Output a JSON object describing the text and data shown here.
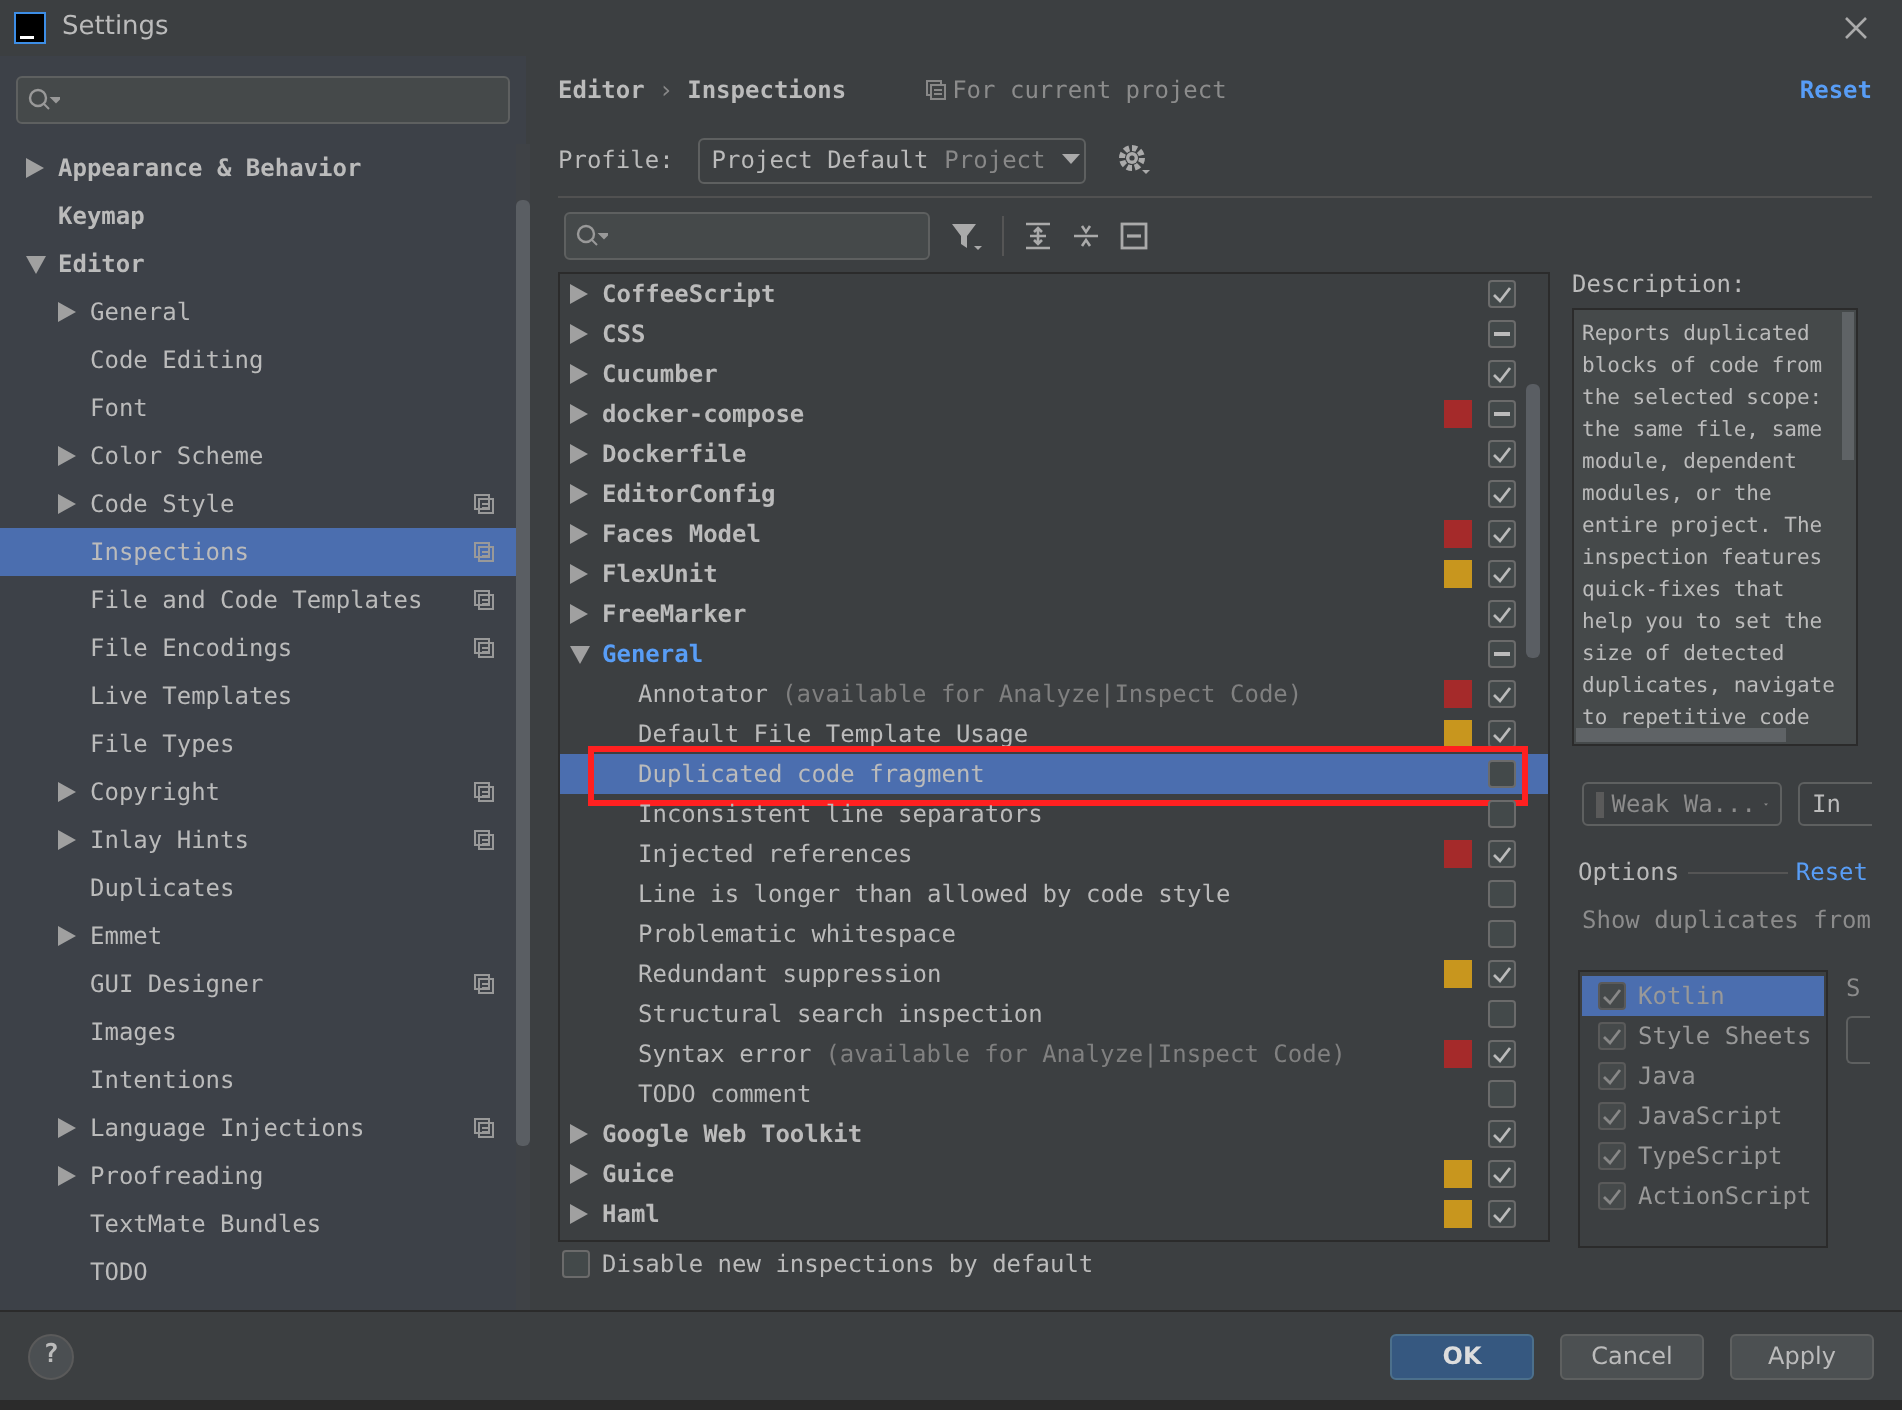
{
  "window": {
    "title": "Settings"
  },
  "sidebar": {
    "items": [
      {
        "label": "Appearance & Behavior",
        "kind": "group",
        "expanded": false,
        "selected": false,
        "project_scoped": false
      },
      {
        "label": "Keymap",
        "kind": "leaf",
        "selected": false,
        "project_scoped": false
      },
      {
        "label": "Editor",
        "kind": "group",
        "expanded": true,
        "selected": false,
        "project_scoped": false,
        "children": [
          {
            "label": "General",
            "kind": "group",
            "expanded": false,
            "selected": false,
            "project_scoped": false
          },
          {
            "label": "Code Editing",
            "kind": "leaf",
            "selected": false,
            "project_scoped": false
          },
          {
            "label": "Font",
            "kind": "leaf",
            "selected": false,
            "project_scoped": false
          },
          {
            "label": "Color Scheme",
            "kind": "group",
            "expanded": false,
            "selected": false,
            "project_scoped": false
          },
          {
            "label": "Code Style",
            "kind": "group",
            "expanded": false,
            "selected": false,
            "project_scoped": true
          },
          {
            "label": "Inspections",
            "kind": "leaf",
            "selected": true,
            "project_scoped": true
          },
          {
            "label": "File and Code Templates",
            "kind": "leaf",
            "selected": false,
            "project_scoped": true
          },
          {
            "label": "File Encodings",
            "kind": "leaf",
            "selected": false,
            "project_scoped": true
          },
          {
            "label": "Live Templates",
            "kind": "leaf",
            "selected": false,
            "project_scoped": false
          },
          {
            "label": "File Types",
            "kind": "leaf",
            "selected": false,
            "project_scoped": false
          },
          {
            "label": "Copyright",
            "kind": "group",
            "expanded": false,
            "selected": false,
            "project_scoped": true
          },
          {
            "label": "Inlay Hints",
            "kind": "group",
            "expanded": false,
            "selected": false,
            "project_scoped": true
          },
          {
            "label": "Duplicates",
            "kind": "leaf",
            "selected": false,
            "project_scoped": false
          },
          {
            "label": "Emmet",
            "kind": "group",
            "expanded": false,
            "selected": false,
            "project_scoped": false
          },
          {
            "label": "GUI Designer",
            "kind": "leaf",
            "selected": false,
            "project_scoped": true
          },
          {
            "label": "Images",
            "kind": "leaf",
            "selected": false,
            "project_scoped": false
          },
          {
            "label": "Intentions",
            "kind": "leaf",
            "selected": false,
            "project_scoped": false
          },
          {
            "label": "Language Injections",
            "kind": "group",
            "expanded": false,
            "selected": false,
            "project_scoped": true
          },
          {
            "label": "Proofreading",
            "kind": "group",
            "expanded": false,
            "selected": false,
            "project_scoped": false
          },
          {
            "label": "TextMate Bundles",
            "kind": "leaf",
            "selected": false,
            "project_scoped": false
          },
          {
            "label": "TODO",
            "kind": "leaf",
            "selected": false,
            "project_scoped": false
          }
        ]
      }
    ]
  },
  "breadcrumb": [
    "Editor",
    "›",
    "Inspections"
  ],
  "scope_note": "For current project",
  "reset": "Reset",
  "profile": {
    "label": "Profile:",
    "value": "Project Default",
    "scope": "Project"
  },
  "inspections": [
    {
      "name": "CoffeeScript",
      "kind": "group",
      "expanded": false,
      "checked": true,
      "mixed": false,
      "selected": false,
      "framed": false
    },
    {
      "name": "CSS",
      "kind": "group",
      "expanded": false,
      "checked": false,
      "mixed": true,
      "selected": false,
      "framed": false
    },
    {
      "name": "Cucumber",
      "kind": "group",
      "expanded": false,
      "checked": true,
      "mixed": false,
      "selected": false,
      "framed": false
    },
    {
      "name": "docker-compose",
      "kind": "group",
      "expanded": false,
      "color": "#a52a2a",
      "checked": false,
      "mixed": true,
      "selected": false,
      "framed": false
    },
    {
      "name": "Dockerfile",
      "kind": "group",
      "expanded": false,
      "checked": true,
      "mixed": false,
      "selected": false,
      "framed": false
    },
    {
      "name": "EditorConfig",
      "kind": "group",
      "expanded": false,
      "checked": true,
      "mixed": false,
      "selected": false,
      "framed": false
    },
    {
      "name": "Faces Model",
      "kind": "group",
      "expanded": false,
      "color": "#a52a2a",
      "checked": true,
      "mixed": false,
      "selected": false,
      "framed": false
    },
    {
      "name": "FlexUnit",
      "kind": "group",
      "expanded": false,
      "color": "#c8961e",
      "checked": true,
      "mixed": false,
      "selected": false,
      "framed": false
    },
    {
      "name": "FreeMarker",
      "kind": "group",
      "expanded": false,
      "checked": true,
      "mixed": false,
      "selected": false,
      "framed": false
    },
    {
      "name": "General",
      "kind": "group",
      "expanded": true,
      "checked": false,
      "mixed": true,
      "selected": false,
      "framed": false,
      "children": [
        {
          "name": "Annotator",
          "note": "(available for Analyze|Inspect Code)",
          "kind": "leaf",
          "color": "#a52a2a",
          "checked": true,
          "mixed": false,
          "selected": false,
          "framed": false
        },
        {
          "name": "Default File Template Usage",
          "kind": "leaf",
          "color": "#c8961e",
          "checked": true,
          "mixed": false,
          "selected": false,
          "framed": false
        },
        {
          "name": "Duplicated code fragment",
          "kind": "leaf",
          "checked": false,
          "mixed": false,
          "selected": true,
          "framed": true
        },
        {
          "name": "Inconsistent line separators",
          "kind": "leaf",
          "checked": false,
          "mixed": false,
          "selected": false,
          "framed": false
        },
        {
          "name": "Injected references",
          "kind": "leaf",
          "color": "#a52a2a",
          "checked": true,
          "mixed": false,
          "selected": false,
          "framed": false
        },
        {
          "name": "Line is longer than allowed by code style",
          "kind": "leaf",
          "checked": false,
          "mixed": false,
          "selected": false,
          "framed": false
        },
        {
          "name": "Problematic whitespace",
          "kind": "leaf",
          "checked": false,
          "mixed": false,
          "selected": false,
          "framed": false
        },
        {
          "name": "Redundant suppression",
          "kind": "leaf",
          "color": "#c8961e",
          "checked": true,
          "mixed": false,
          "selected": false,
          "framed": false
        },
        {
          "name": "Structural search inspection",
          "kind": "leaf",
          "checked": false,
          "mixed": false,
          "selected": false,
          "framed": false
        },
        {
          "name": "Syntax error",
          "note": "(available for Analyze|Inspect Code)",
          "kind": "leaf",
          "color": "#a52a2a",
          "checked": true,
          "mixed": false,
          "selected": false,
          "framed": false
        },
        {
          "name": "TODO comment",
          "kind": "leaf",
          "checked": false,
          "mixed": false,
          "selected": false,
          "framed": false
        }
      ]
    },
    {
      "name": "Google Web Toolkit",
      "kind": "group",
      "expanded": false,
      "checked": true,
      "mixed": false,
      "selected": false,
      "framed": false
    },
    {
      "name": "Guice",
      "kind": "group",
      "expanded": false,
      "color": "#c8961e",
      "checked": true,
      "mixed": false,
      "selected": false,
      "framed": false
    },
    {
      "name": "Haml",
      "kind": "group",
      "expanded": false,
      "color": "#c8961e",
      "checked": true,
      "mixed": false,
      "selected": false,
      "framed": false
    }
  ],
  "disable_new": {
    "label": "Disable new inspections by default",
    "checked": false
  },
  "description": {
    "label": "Description:",
    "lines": [
      "Reports duplicated",
      "blocks of code from",
      "the selected scope:",
      "the same file, same",
      "module, dependent",
      "modules, or the",
      "entire project. The",
      "inspection features",
      "quick-fixes that",
      "help you to set the",
      "size of detected",
      "duplicates, navigate",
      "to repetitive code"
    ]
  },
  "severity": {
    "value": "Weak Wa...",
    "scope_value": "In"
  },
  "options": {
    "title": "Options",
    "reset": "Reset",
    "hint": "Show duplicates from",
    "side_label": "S",
    "languages": [
      {
        "label": "Kotlin",
        "checked": true,
        "selected": true
      },
      {
        "label": "Style Sheets",
        "checked": true,
        "selected": false
      },
      {
        "label": "Java",
        "checked": true,
        "selected": false
      },
      {
        "label": "JavaScript",
        "checked": true,
        "selected": false
      },
      {
        "label": "TypeScript",
        "checked": true,
        "selected": false
      },
      {
        "label": "ActionScript",
        "checked": true,
        "selected": false
      }
    ]
  },
  "help": "?",
  "buttons": [
    {
      "label": "OK",
      "kind": "default"
    },
    {
      "label": "Cancel",
      "kind": "normal"
    },
    {
      "label": "Apply",
      "kind": "mnemonic"
    }
  ]
}
